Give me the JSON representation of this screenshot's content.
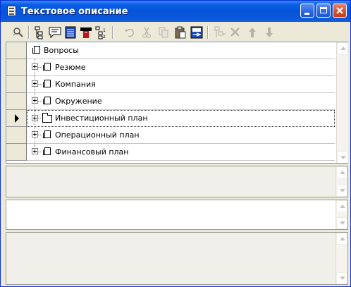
{
  "window": {
    "title": "Текстовое описание"
  },
  "toolbar": {
    "tools": [
      {
        "name": "find-tool-icon",
        "enabled": true
      },
      {
        "name": "tree-structure-icon",
        "enabled": true
      },
      {
        "name": "comment-icon",
        "enabled": true
      },
      {
        "name": "text-list-icon",
        "enabled": true
      },
      {
        "name": "red-book-icon",
        "enabled": true
      },
      {
        "name": "numbering-icon",
        "enabled": true
      },
      {
        "name": "undo-icon",
        "enabled": false
      },
      {
        "name": "cut-icon",
        "enabled": false
      },
      {
        "name": "copy-icon",
        "enabled": false
      },
      {
        "name": "paste-icon",
        "enabled": true
      },
      {
        "name": "import-icon",
        "enabled": true
      },
      {
        "name": "add-node-icon",
        "enabled": false
      },
      {
        "name": "delete-icon",
        "enabled": false
      },
      {
        "name": "move-up-icon",
        "enabled": false
      },
      {
        "name": "move-down-icon",
        "enabled": false
      }
    ]
  },
  "tree": {
    "root": {
      "label": "Вопросы"
    },
    "items": [
      {
        "label": "Резюме",
        "selected": false
      },
      {
        "label": "Компания",
        "selected": false
      },
      {
        "label": "Окружение",
        "selected": false
      },
      {
        "label": "Инвестиционный план",
        "selected": true
      },
      {
        "label": "Операционный план",
        "selected": false
      },
      {
        "label": "Финансовый план",
        "selected": false
      }
    ]
  },
  "colors": {
    "title_bar": "#0653d9",
    "window_bg": "#ece9d8",
    "close_button": "#d4502e"
  }
}
